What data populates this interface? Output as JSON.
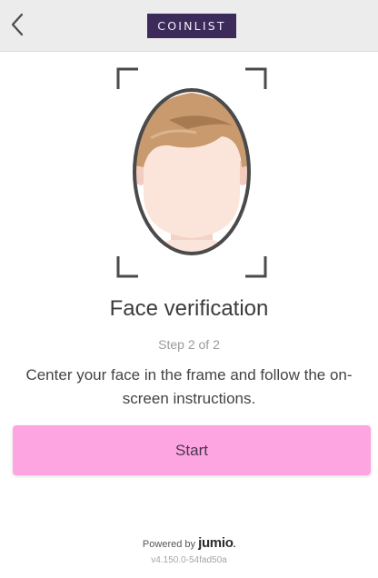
{
  "header": {
    "back_icon": "chevron-left-icon",
    "logo_text": "COINLIST"
  },
  "colors": {
    "header_bg": "#ececec",
    "logo_bg": "#3b2a5a",
    "button_bg": "#fca5e0",
    "hair": "#c89a6e",
    "skin": "#fbe4da"
  },
  "main": {
    "illustration": "face-frame-icon",
    "title": "Face verification",
    "step": "Step 2 of 2",
    "instructions": "Center your face in the frame and follow the on-screen instructions.",
    "start_label": "Start"
  },
  "footer": {
    "powered_by": "Powered by",
    "brand": "jumio",
    "version": "v4.150.0-54fad50a"
  }
}
